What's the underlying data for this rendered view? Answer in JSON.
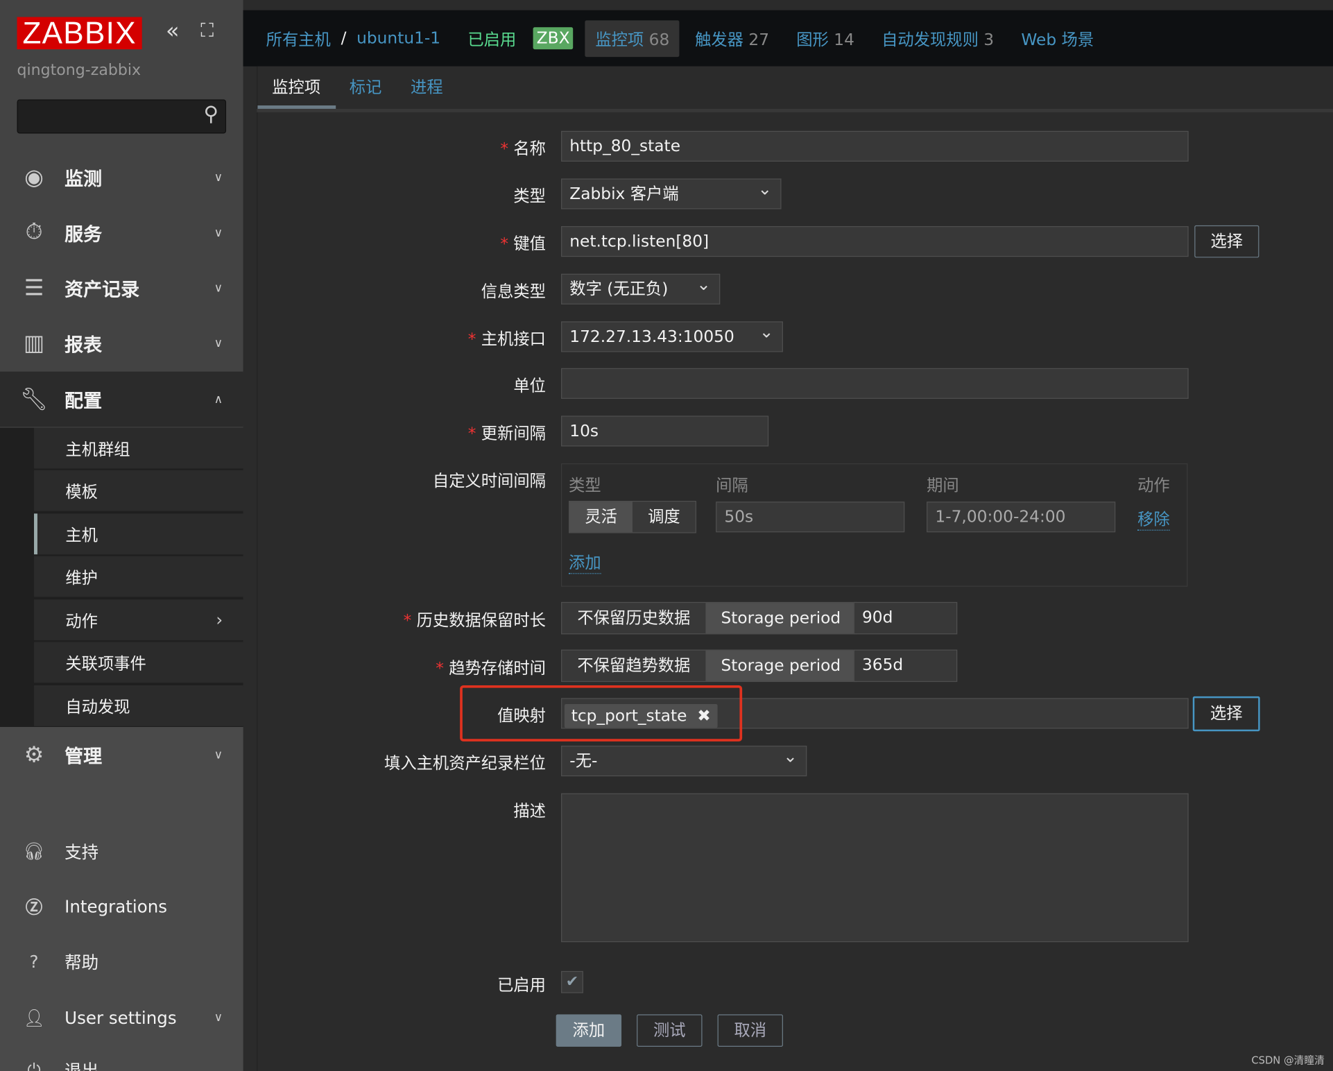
{
  "sidebar": {
    "logo": "ZABBIX",
    "server_name": "qingtong-zabbix",
    "search_placeholder": "",
    "menu": [
      {
        "label": "监测",
        "icon": "eye-icon"
      },
      {
        "label": "服务",
        "icon": "stopwatch-icon"
      },
      {
        "label": "资产记录",
        "icon": "list-icon"
      },
      {
        "label": "报表",
        "icon": "bar-chart-icon"
      },
      {
        "label": "配置",
        "icon": "wrench-icon"
      }
    ],
    "submenu": [
      "主机群组",
      "模板",
      "主机",
      "维护",
      "动作",
      "关联项事件",
      "自动发现"
    ],
    "admin": "管理",
    "bottom": [
      "支持",
      "Integrations",
      "帮助",
      "User settings",
      "退出"
    ]
  },
  "header": {
    "breadcrumb_all": "所有主机",
    "separator": "/",
    "host": "ubuntu1-1",
    "status": "已启用",
    "zbx": "ZBX",
    "links": [
      {
        "label": "监控项",
        "count": "68"
      },
      {
        "label": "触发器",
        "count": "27"
      },
      {
        "label": "图形",
        "count": "14"
      },
      {
        "label": "自动发现规则",
        "count": "3"
      },
      {
        "label": "Web 场景",
        "count": ""
      }
    ]
  },
  "tabs": [
    "监控项",
    "标记",
    "进程"
  ],
  "form": {
    "name": {
      "label": "名称",
      "value": "http_80_state"
    },
    "type": {
      "label": "类型",
      "value": "Zabbix 客户端"
    },
    "key": {
      "label": "键值",
      "value": "net.tcp.listen[80]",
      "button": "选择"
    },
    "info_type": {
      "label": "信息类型",
      "value": "数字 (无正负)"
    },
    "interface": {
      "label": "主机接口",
      "value": "172.27.13.43:10050"
    },
    "units": {
      "label": "单位",
      "value": ""
    },
    "interval": {
      "label": "更新间隔",
      "value": "10s"
    },
    "custom": {
      "label": "自定义时间间隔",
      "col_type": "类型",
      "col_interval": "间隔",
      "col_period": "期间",
      "col_action": "动作",
      "flex": "灵活",
      "schedule": "调度",
      "interval_value": "50s",
      "period_value": "1-7,00:00-24:00",
      "remove": "移除",
      "add": "添加"
    },
    "history": {
      "label": "历史数据保留时长",
      "off": "不保留历史数据",
      "on": "Storage period",
      "value": "90d"
    },
    "trends": {
      "label": "趋势存储时间",
      "off": "不保留趋势数据",
      "on": "Storage period",
      "value": "365d"
    },
    "valuemap": {
      "label": "值映射",
      "tag": "tcp_port_state",
      "button": "选择",
      "highlight_color": "#e0321f"
    },
    "inventory": {
      "label": "填入主机资产纪录栏位",
      "value": "-无-"
    },
    "description": {
      "label": "描述",
      "value": ""
    },
    "enabled": {
      "label": "已启用",
      "checked": true
    }
  },
  "buttons": {
    "add": "添加",
    "test": "测试",
    "cancel": "取消"
  },
  "watermark": "CSDN @清瞳清"
}
